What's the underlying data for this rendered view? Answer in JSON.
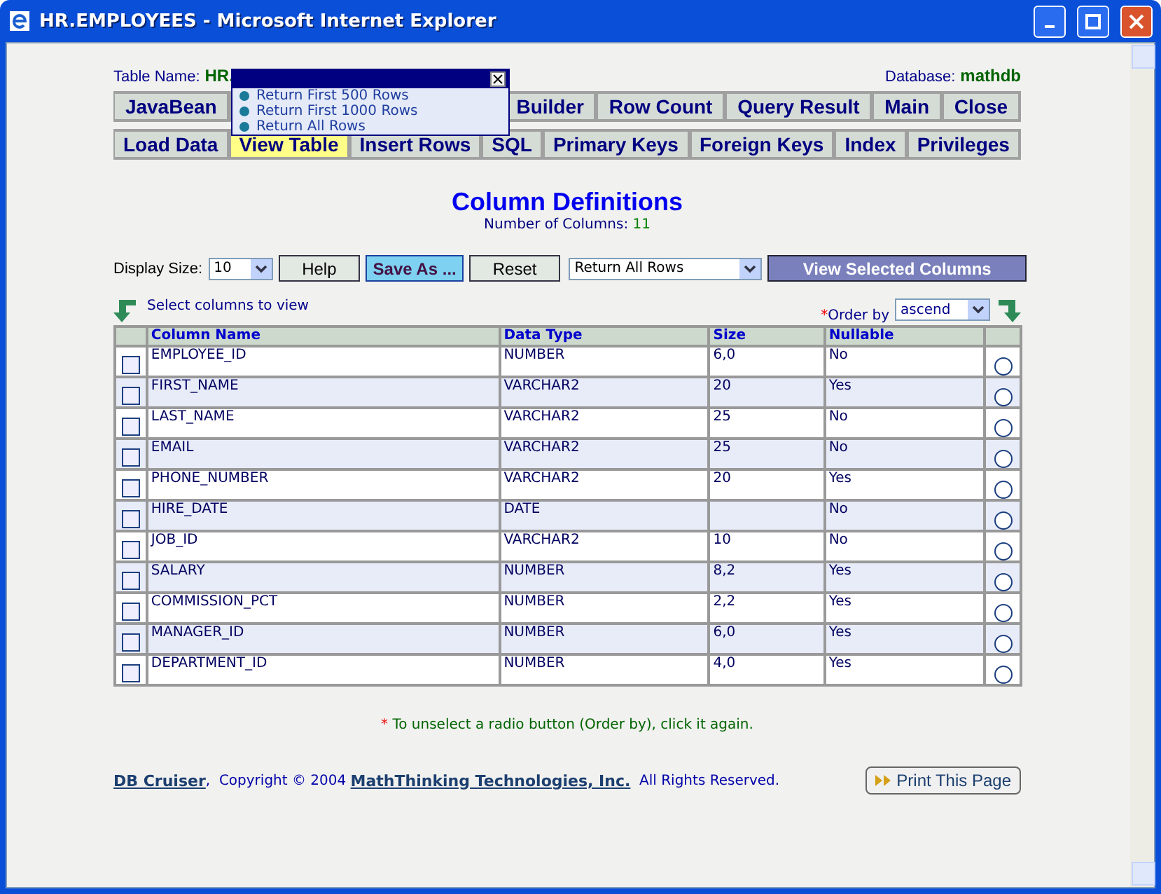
{
  "window": {
    "title": "HR.EMPLOYEES - Microsoft Internet Explorer"
  },
  "table_name": {
    "label": "Table Name:",
    "value": "HR."
  },
  "database": {
    "label": "Database:",
    "value": "mathdb"
  },
  "nav_rows": [
    [
      {
        "label": "JavaBean",
        "selected": false,
        "kind": "tab"
      },
      {
        "kind": "covered"
      },
      {
        "label": "Builder",
        "selected": false,
        "kind": "tab"
      },
      {
        "label": "Row Count",
        "selected": false,
        "kind": "tab"
      },
      {
        "label": "Query Result",
        "selected": false,
        "kind": "tab"
      },
      {
        "label": "Main",
        "selected": false,
        "kind": "tab"
      },
      {
        "label": "Close",
        "selected": false,
        "kind": "tab"
      }
    ],
    [
      {
        "label": "Load Data",
        "selected": false,
        "kind": "tab"
      },
      {
        "label": "View Table",
        "selected": true,
        "kind": "tab"
      },
      {
        "label": "Insert Rows",
        "selected": false,
        "kind": "tab"
      },
      {
        "label": "SQL",
        "selected": false,
        "kind": "tab"
      },
      {
        "label": "Primary Keys",
        "selected": false,
        "kind": "tab"
      },
      {
        "label": "Foreign Keys",
        "selected": false,
        "kind": "tab"
      },
      {
        "label": "Index",
        "selected": false,
        "kind": "tab"
      },
      {
        "label": "Privileges",
        "selected": false,
        "kind": "tab"
      }
    ]
  ],
  "popup_menu": {
    "items": [
      "Return First 500 Rows",
      "Return First 1000 Rows",
      "Return All Rows"
    ]
  },
  "heading": "Column Definitions",
  "column_count": {
    "label": "Number of Columns:",
    "value": "11"
  },
  "controls": {
    "display_size_label": "Display Size:",
    "display_size": "10",
    "buttons": [
      "Help",
      "Save As ...",
      "Reset"
    ],
    "rows_select": "Return All Rows",
    "view_button": "View Selected Columns"
  },
  "select_hint": "Select columns to view",
  "order_by": {
    "mark": "*",
    "label": "Order by",
    "value": "ascend"
  },
  "table": {
    "columns": [
      "Column Name",
      "Data Type",
      "Size",
      "Nullable"
    ],
    "rows": [
      {
        "cells": [
          "EMPLOYEE_ID",
          "NUMBER",
          "6,0",
          "No"
        ],
        "checked": false,
        "selected": false
      },
      {
        "cells": [
          "FIRST_NAME",
          "VARCHAR2",
          "20",
          "Yes"
        ],
        "checked": false,
        "selected": false
      },
      {
        "cells": [
          "LAST_NAME",
          "VARCHAR2",
          "25",
          "No"
        ],
        "checked": false,
        "selected": false
      },
      {
        "cells": [
          "EMAIL",
          "VARCHAR2",
          "25",
          "No"
        ],
        "checked": false,
        "selected": false
      },
      {
        "cells": [
          "PHONE_NUMBER",
          "VARCHAR2",
          "20",
          "Yes"
        ],
        "checked": false,
        "selected": false
      },
      {
        "cells": [
          "HIRE_DATE",
          "DATE",
          "",
          "No"
        ],
        "checked": false,
        "selected": false
      },
      {
        "cells": [
          "JOB_ID",
          "VARCHAR2",
          "10",
          "No"
        ],
        "checked": false,
        "selected": false
      },
      {
        "cells": [
          "SALARY",
          "NUMBER",
          "8,2",
          "Yes"
        ],
        "checked": false,
        "selected": false
      },
      {
        "cells": [
          "COMMISSION_PCT",
          "NUMBER",
          "2,2",
          "Yes"
        ],
        "checked": false,
        "selected": false
      },
      {
        "cells": [
          "MANAGER_ID",
          "NUMBER",
          "6,0",
          "Yes"
        ],
        "checked": false,
        "selected": false
      },
      {
        "cells": [
          "DEPARTMENT_ID",
          "NUMBER",
          "4,0",
          "Yes"
        ],
        "checked": false,
        "selected": false
      }
    ]
  },
  "note": {
    "mark": "*",
    "text": "To unselect a radio button (Order by), click it again."
  },
  "footer": {
    "product_link": "DB Cruiser",
    "separator": ",",
    "copyright": "Copyright © 2004",
    "company_link": "MathThinking Technologies, Inc.",
    "rights": "All Rights Reserved.",
    "print_button": "Print This Page"
  }
}
